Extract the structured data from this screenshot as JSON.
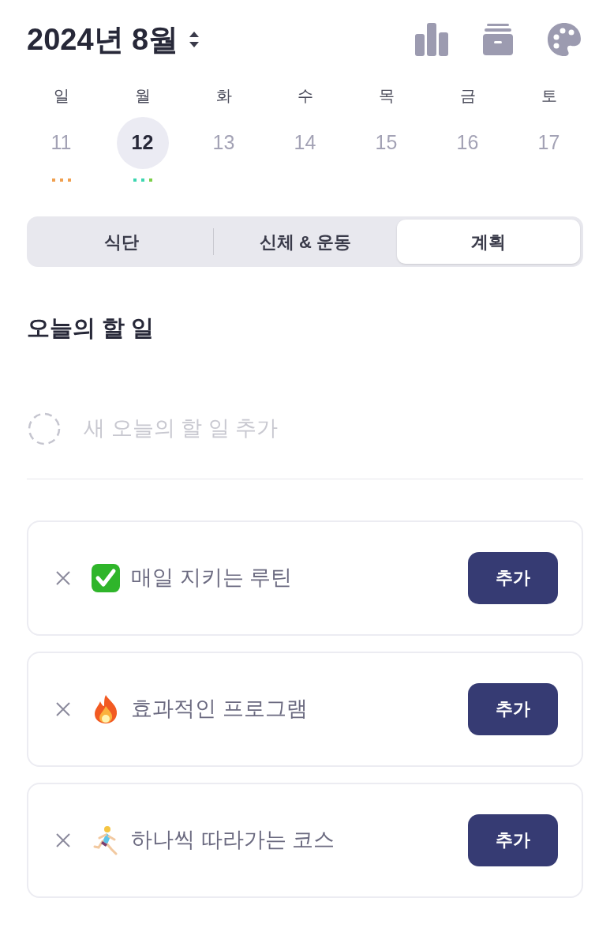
{
  "header": {
    "title": "2024년 8월"
  },
  "week": [
    {
      "weekday": "일",
      "date": "11",
      "selected": false,
      "dots": [
        {
          "color": "#f0a050"
        },
        {
          "color": "#f0a050"
        },
        {
          "color": "#f0a050"
        }
      ]
    },
    {
      "weekday": "월",
      "date": "12",
      "selected": true,
      "dots": [
        {
          "color": "#3dd6b0"
        },
        {
          "color": "#3dd6b0"
        },
        {
          "color": "#7ccf4a"
        }
      ]
    },
    {
      "weekday": "화",
      "date": "13",
      "selected": false
    },
    {
      "weekday": "수",
      "date": "14",
      "selected": false
    },
    {
      "weekday": "목",
      "date": "15",
      "selected": false
    },
    {
      "weekday": "금",
      "date": "16",
      "selected": false
    },
    {
      "weekday": "토",
      "date": "17",
      "selected": false
    }
  ],
  "tabs": [
    {
      "label": "식단",
      "selected": false
    },
    {
      "label": "신체 & 운동",
      "selected": false
    },
    {
      "label": "계획",
      "selected": true
    }
  ],
  "section_title": "오늘의 할 일",
  "new_todo": {
    "placeholder": "새 오늘의 할 일 추가"
  },
  "suggestions": [
    {
      "kind": "check",
      "label": "매일 지키는 루틴",
      "button": "추가"
    },
    {
      "kind": "fire",
      "label": "효과적인 프로그램",
      "button": "추가"
    },
    {
      "kind": "runner",
      "label": "하나씩 따라가는 코스",
      "button": "추가"
    }
  ]
}
